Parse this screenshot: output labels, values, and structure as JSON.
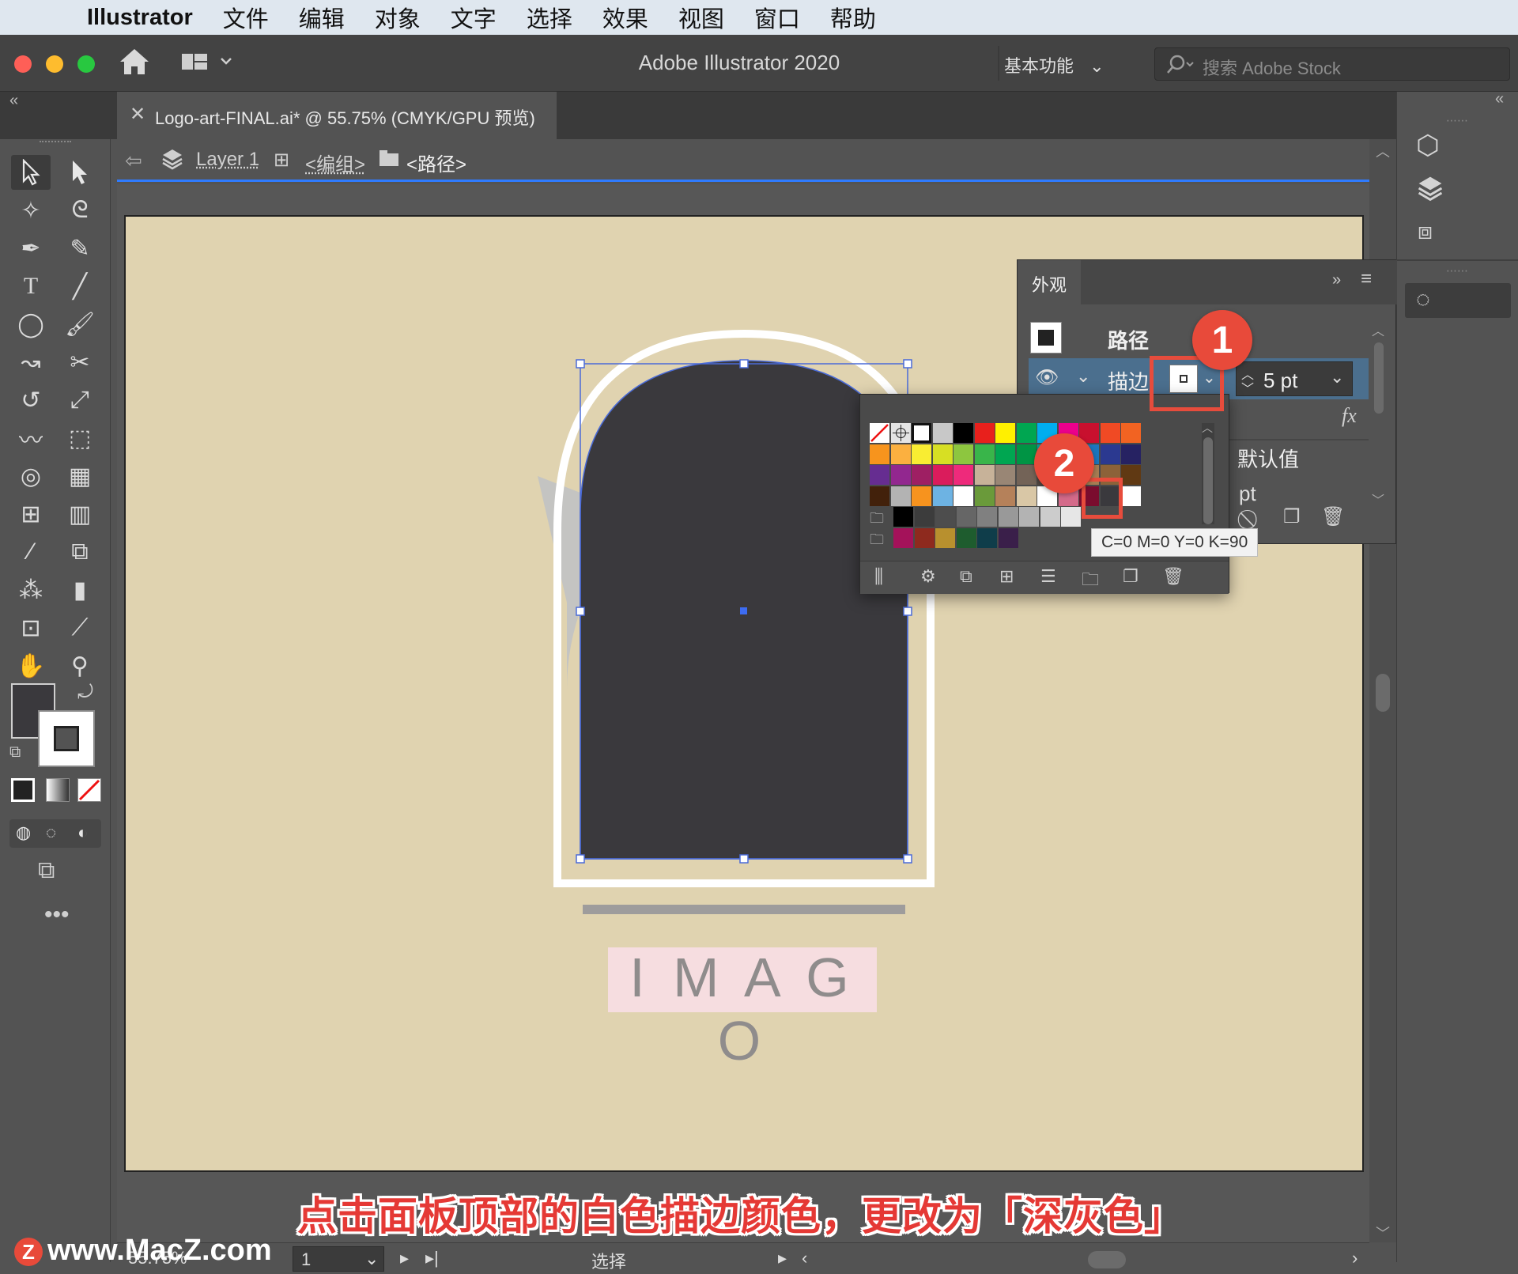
{
  "menubar": {
    "app_name": "Illustrator",
    "items": [
      "文件",
      "编辑",
      "对象",
      "文字",
      "选择",
      "效果",
      "视图",
      "窗口",
      "帮助"
    ]
  },
  "titlebar": {
    "title": "Adobe Illustrator 2020",
    "workspace": "基本功能",
    "search_placeholder": "搜索 Adobe Stock"
  },
  "document_tab": {
    "label": "Logo-art-FINAL.ai* @ 55.75% (CMYK/GPU 预览)"
  },
  "breadcrumb": {
    "layer": "Layer 1",
    "group": "<编组>",
    "path": "<路径>"
  },
  "artwork": {
    "logo_text": "I M A G O"
  },
  "appearance_panel": {
    "title": "外观",
    "object_label": "路径",
    "stroke_label": "描边:",
    "stroke_weight": "5 pt",
    "fx_label": "fx",
    "default_label": "默认值",
    "partial_label": "pt"
  },
  "tooltip": {
    "text": "C=0 M=0 Y=0 K=90"
  },
  "badges": [
    "1",
    "2"
  ],
  "subtitle": "点击面板顶部的白色描边颜色，更改为「深灰色」",
  "statusbar": {
    "zoom": "55.75%",
    "artboard_number": "1",
    "mode": "选择"
  },
  "watermark": "www.MacZ.com",
  "colors": {
    "accent": "#2f7bff",
    "annotation_red": "#e74c3c",
    "artboard": "#e0d3b0",
    "shape_fill": "#3a393d"
  },
  "swatch_colors": [
    [
      "#ffffff",
      "#e5e5e5",
      "#ffffff",
      "#c8c8c8",
      "#000000",
      "#e8201c",
      "#fff000",
      "#00a651",
      "#00aeef",
      "#ec008c",
      "#c8102e",
      "#f04a24",
      "#f26322"
    ],
    [
      "#f7941d",
      "#fbb040",
      "#f9ed32",
      "#d7df23",
      "#8dc63f",
      "#39b54a",
      "#00a651",
      "#009444",
      "#00a79d",
      "#27aae1",
      "#1c75bc",
      "#2b3990",
      "#262262"
    ],
    [
      "#662d91",
      "#92278f",
      "#9e1f63",
      "#da1c5c",
      "#ee2a7b",
      "#c7b299",
      "#998675",
      "#736357",
      "#534741",
      "#c69c6d",
      "#a67c52",
      "#8c6239",
      "#603913"
    ],
    [
      "#42210b",
      "#b3b3b3",
      "#f7931e",
      "#6db3e3",
      "#ffffff",
      "#6a9a3a",
      "#b5815a",
      "#d9c7a6",
      "#ffffff",
      "#d46a8a",
      "#7a0c2e",
      "#3a393d",
      "#ffffff"
    ],
    [
      "#000000",
      "#3c3c3c",
      "#4d4d4d",
      "#666666",
      "#808080",
      "#999999",
      "#b3b3b3",
      "#cccccc",
      "#e6e6e6"
    ],
    [
      "#a4125a",
      "#8e2a1e",
      "#b8902e",
      "#1e5c2e",
      "#0f3d4a",
      "#3a1f4a"
    ]
  ]
}
